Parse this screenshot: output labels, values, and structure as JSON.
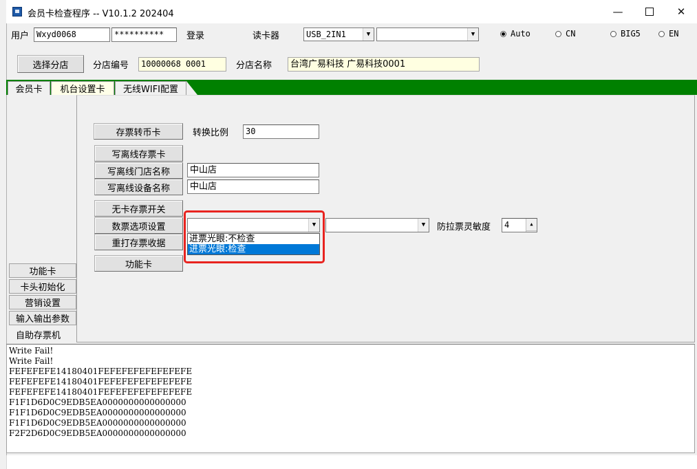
{
  "window": {
    "title": "会员卡检查程序 -- V10.1.2 202404"
  },
  "login": {
    "user_label": "用户",
    "user_value": "Wxyd0068",
    "password_value": "**********",
    "login_label": "登录",
    "reader_label": "读卡器",
    "reader_value": "USB_2IN1",
    "reader2_value": ""
  },
  "encoding": [
    {
      "label": "Auto",
      "checked": true
    },
    {
      "label": "CN",
      "checked": false
    },
    {
      "label": "BIG5",
      "checked": false
    },
    {
      "label": "EN",
      "checked": false
    }
  ],
  "branch": {
    "select_button": "选择分店",
    "number_label": "分店编号",
    "number_value": "10000068 0001",
    "name_label": "分店名称",
    "name_value": "台湾广易科技 广易科技0001"
  },
  "tabs": [
    {
      "label": "会员卡",
      "active": false
    },
    {
      "label": "机台设置卡",
      "active": true
    },
    {
      "label": "无线WIFI配置",
      "active": false
    }
  ],
  "sidebar": {
    "items": [
      "功能卡",
      "卡头初始化",
      "营销设置",
      "输入输出参数"
    ],
    "last_label": "自助存票机"
  },
  "machine": {
    "convert_button": "存票转币卡",
    "ratio_label": "转换比例",
    "ratio_value": "30",
    "write_offline_card": "写离线存票卡",
    "write_store_name": "写离线门店名称",
    "store_name_value": "中山店",
    "write_device_name": "写离线设备名称",
    "device_name_value": "中山店",
    "no_card_switch": "无卡存票开关",
    "count_option": "数票选项设置",
    "count_option_value": "",
    "count_option2_value": "",
    "anti_pull_label": "防拉票灵敏度",
    "anti_pull_value": "4",
    "reprint": "重打存票收据",
    "function_card": "功能卡",
    "dropdown_options": [
      "进票光眼:不检查",
      "进票光眼:检查"
    ],
    "dropdown_selected_index": 1
  },
  "log": [
    "Write Fail!",
    "Write Fail!",
    "FEFEFEFE14180401FEFEFEFEFEFEFEFE",
    "FEFEFEFE14180401FEFEFEFEFEFEFEFE",
    "FEFEFEFE14180401FEFEFEFEFEFEFEFE",
    "F1F1D6D0C9EDB5EA0000000000000000",
    "F1F1D6D0C9EDB5EA0000000000000000",
    "F1F1D6D0C9EDB5EA0000000000000000",
    "F2F2D6D0C9EDB5EA0000000000000000"
  ],
  "colors": {
    "tab_bar": "#008000",
    "highlight": "#e8231f",
    "selection": "#0078d7",
    "info_field": "#ffffe1"
  }
}
